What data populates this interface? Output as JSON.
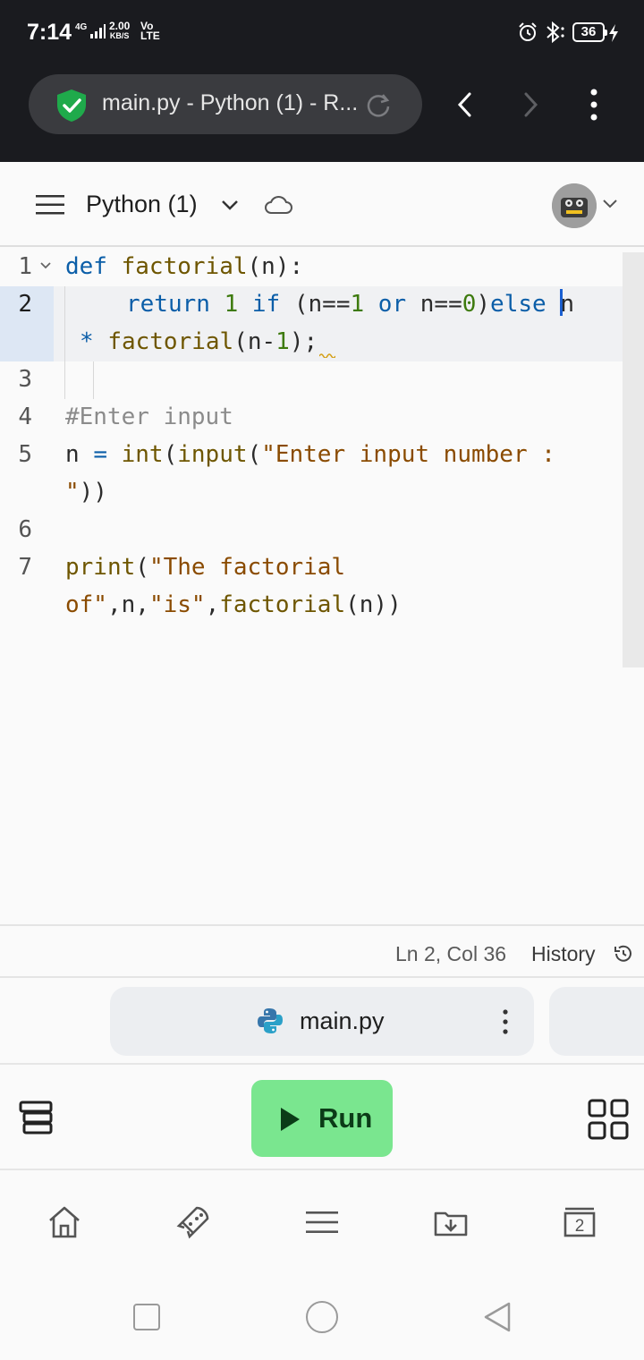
{
  "status_bar": {
    "time": "7:14",
    "network_type": "4G",
    "speed_value": "2.00",
    "speed_unit": "KB/S",
    "volte_top": "Vo",
    "volte_bottom": "LTE",
    "battery": "36"
  },
  "browser": {
    "tab_title": "main.py - Python (1) - R...",
    "security": "secure"
  },
  "app_header": {
    "project_title": "Python (1)"
  },
  "editor": {
    "line_numbers": [
      "1",
      "2",
      "3",
      "4",
      "5",
      "6",
      "7"
    ],
    "active_line": 2,
    "code": {
      "line1": {
        "kw": "def",
        "fn": "factorial",
        "rest": "(n):"
      },
      "line2": {
        "kw_return": "return",
        "num1": "1",
        "kw_if": "if",
        "p1": "(n==",
        "num2": "1",
        "kw_or": "or",
        "p2": "n==",
        "num3": "0",
        "p3": ")",
        "kw_else": "else",
        "tail": "n",
        "wrap_op": "*",
        "wrap_fn": "factorial",
        "wrap_p": "(n-",
        "wrap_num": "1",
        "wrap_end": ");"
      },
      "line4": {
        "comment": "#Enter input"
      },
      "line5": {
        "var": "n",
        "eq": "=",
        "fn_int": "int",
        "p1": "(",
        "fn_input": "input",
        "p2": "(",
        "str": "\"Enter input number :",
        "wrap_str": "\"",
        "wrap_end": "))"
      },
      "line7": {
        "fn": "print",
        "p1": "(",
        "str1": "\"The factorial",
        "wrap_str1": "of\"",
        "c1": ",n,",
        "str2": "\"is\"",
        "c2": ",",
        "fn2": "factorial",
        "end": "(n))"
      }
    }
  },
  "editor_status": {
    "cursor_position": "Ln 2, Col 36",
    "history_label": "History"
  },
  "file_tab": {
    "name": "main.py"
  },
  "toolbar": {
    "run_label": "Run"
  },
  "bottom_nav": {
    "items": [
      "home-icon",
      "explore-icon",
      "menu-icon",
      "import-icon",
      "tabs-icon"
    ],
    "tabs_count": "2"
  },
  "colors": {
    "run_button": "#7ae68f",
    "keyword": "#0b5ea8",
    "function": "#6e5600",
    "string": "#8a4b00",
    "number": "#3d7a0d",
    "comment": "#8b8b8b",
    "secure_shield": "#1faa4b"
  }
}
